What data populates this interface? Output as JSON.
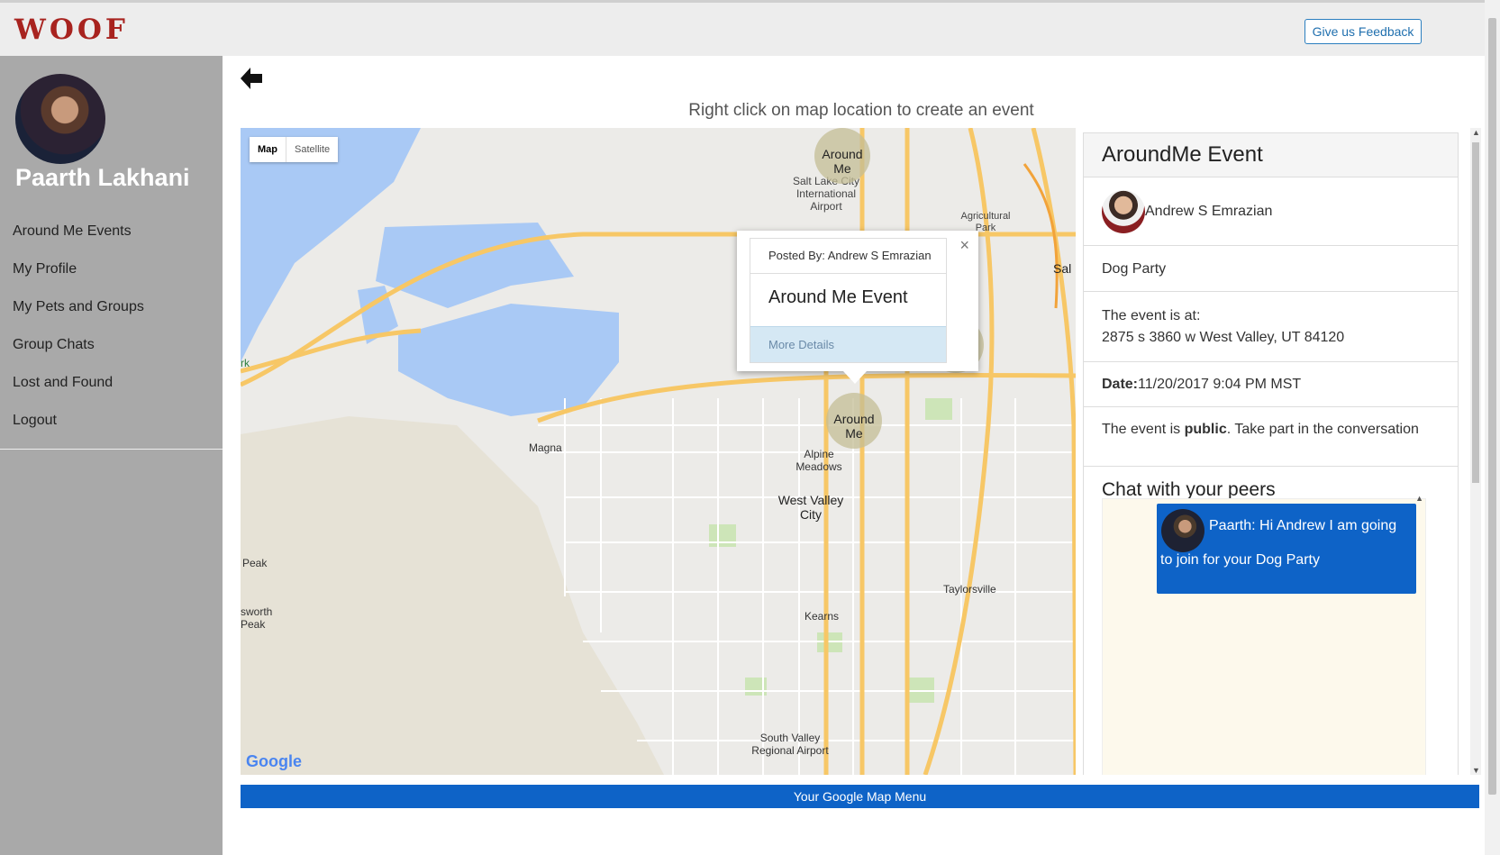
{
  "header": {
    "logo": "WOOF",
    "feedback_label": "Give us Feedback"
  },
  "sidebar": {
    "user_name": "Paarth Lakhani",
    "items": [
      {
        "label": "Around Me Events"
      },
      {
        "label": "My Profile"
      },
      {
        "label": "My Pets and Groups"
      },
      {
        "label": "Group Chats"
      },
      {
        "label": "Lost and Found"
      },
      {
        "label": "Logout"
      }
    ]
  },
  "main": {
    "instruction": "Right click on map location to create an event",
    "back_icon": "arrow-left-icon",
    "map_menu_label": "Your Google Map Menu"
  },
  "map": {
    "type_map": "Map",
    "type_satellite": "Satellite",
    "attribution": "Google",
    "marker_label": "Around Me",
    "places": {
      "airport": "Salt Lake City International Airport",
      "agri_park": "Agricultural Park",
      "magna": "Magna",
      "alpine": "Alpine Meadows",
      "west_valley": "West Valley City",
      "kearns": "Kearns",
      "taylorsville": "Taylorsville",
      "sv_airport": "South Valley Regional Airport",
      "peak": "Peak",
      "farnsworth": "sworth Peak",
      "park_partial": "rk",
      "sal": "Sal"
    },
    "infowindow": {
      "posted_by": "Posted By: Andrew S Emrazian",
      "title": "Around Me Event",
      "more_details": "More Details"
    }
  },
  "event_panel": {
    "title": "AroundMe Event",
    "poster_name": "Andrew S Emrazian",
    "event_name": "Dog Party",
    "location_label": "The event is at:",
    "address": "2875 s 3860 w West Valley, UT 84120",
    "date_label": "Date:",
    "date_value": "11/20/2017 9:04 PM MST",
    "visibility_prefix": "The event is ",
    "visibility_value": "public",
    "visibility_suffix": ". Take part in the conversation",
    "chat_title": "Chat with your peers",
    "messages": [
      {
        "text": "Paarth: Hi Andrew I am going to join for your Dog Party"
      }
    ]
  }
}
